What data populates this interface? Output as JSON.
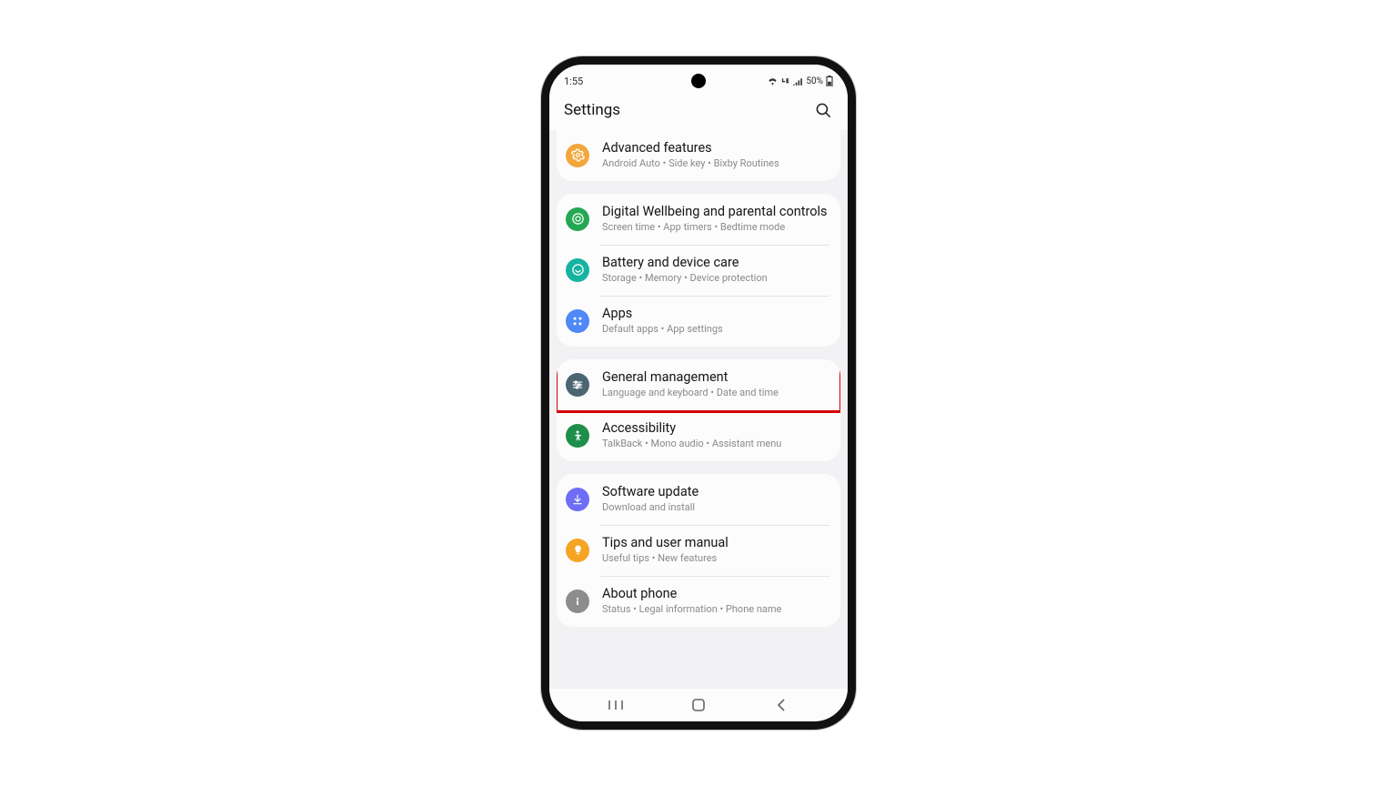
{
  "status": {
    "time": "1:55",
    "battery_text": "50%"
  },
  "header": {
    "title": "Settings"
  },
  "highlighted_id": "general-management",
  "groups": [
    {
      "items": [
        {
          "id": "advanced-features",
          "title": "Advanced features",
          "sub": "Android Auto  •  Side key  •  Bixby Routines",
          "icon_bg": "#f2a73c",
          "icon": "gear"
        }
      ]
    },
    {
      "items": [
        {
          "id": "digital-wellbeing",
          "title": "Digital Wellbeing and parental controls",
          "sub": "Screen time  •  App timers  •  Bedtime mode",
          "icon_bg": "#24a852",
          "icon": "target"
        },
        {
          "id": "device-care",
          "title": "Battery and device care",
          "sub": "Storage  •  Memory  •  Device protection",
          "icon_bg": "#16b3a0",
          "icon": "care"
        },
        {
          "id": "apps",
          "title": "Apps",
          "sub": "Default apps  •  App settings",
          "icon_bg": "#4f88f7",
          "icon": "grid"
        }
      ]
    },
    {
      "items": [
        {
          "id": "general-management",
          "title": "General management",
          "sub": "Language and keyboard  •  Date and time",
          "icon_bg": "#4b6572",
          "icon": "sliders"
        },
        {
          "id": "accessibility",
          "title": "Accessibility",
          "sub": "TalkBack  •  Mono audio  •  Assistant menu",
          "icon_bg": "#1e8f4a",
          "icon": "person"
        }
      ]
    },
    {
      "items": [
        {
          "id": "software-update",
          "title": "Software update",
          "sub": "Download and install",
          "icon_bg": "#6d6df5",
          "icon": "download"
        },
        {
          "id": "tips",
          "title": "Tips and user manual",
          "sub": "Useful tips  •  New features",
          "icon_bg": "#f5a523",
          "icon": "bulb"
        },
        {
          "id": "about-phone",
          "title": "About phone",
          "sub": "Status  •  Legal information  •  Phone name",
          "icon_bg": "#8d8d8d",
          "icon": "info"
        }
      ]
    }
  ]
}
